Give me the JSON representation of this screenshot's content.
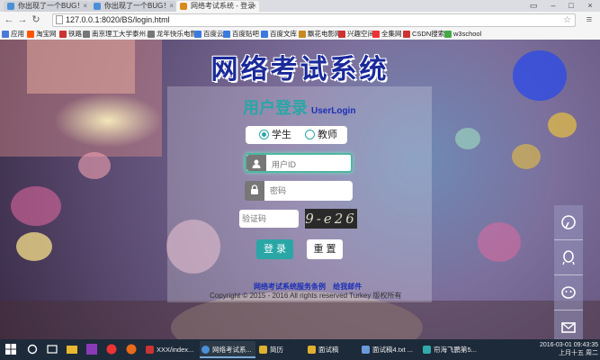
{
  "browser": {
    "tabs": [
      {
        "label": "你出现了一个BUG！",
        "icon_color": "#4a90d9"
      },
      {
        "label": "你出现了一个BUG！",
        "icon_color": "#4a90d9"
      },
      {
        "label": "网络考试系统 - 登录",
        "icon_color": "#d98a1a"
      }
    ],
    "url": "127.0.0.1:8020/BS/login.html",
    "bookmarks": [
      {
        "label": "应用",
        "color": "#4a7ad9"
      },
      {
        "label": "淘宝网",
        "color": "#ff5500"
      },
      {
        "label": "铁路",
        "color": "#c33"
      },
      {
        "label": "南京理工大学泰州...",
        "color": "#777"
      },
      {
        "label": "龙年快乐电影",
        "color": "#777"
      },
      {
        "label": "百度云",
        "color": "#3a7ae0"
      },
      {
        "label": "百度贴吧",
        "color": "#3a7ae0"
      },
      {
        "label": "百度文库",
        "color": "#3a7ae0"
      },
      {
        "label": "飘花电影网",
        "color": "#c98a20"
      },
      {
        "label": "兴趣空间",
        "color": "#c33"
      },
      {
        "label": "全集网",
        "color": "#e33"
      },
      {
        "label": "CSDN搜索",
        "color": "#c33"
      },
      {
        "label": "w3school",
        "color": "#4a4"
      }
    ]
  },
  "page": {
    "title": "网络考试系统",
    "login_heading": "用户登录",
    "login_heading_en": "UserLogin",
    "roles": [
      "学生",
      "教师"
    ],
    "selected_role": "学生",
    "userid_placeholder": "用户ID",
    "password_placeholder": "密码",
    "captcha_placeholder": "验证码",
    "captcha_text": "9-e26",
    "login_button": "登 录",
    "reset_button": "重 置",
    "footer_links": [
      "网络考试系统服务条例",
      "给我邮件"
    ],
    "copyright": "Copyright © 2015 - 2016 All rights reserved Turkey 版权所有"
  },
  "sidebar_icons": [
    "help-icon",
    "qq-icon",
    "wechat-icon",
    "mail-icon"
  ],
  "taskbar": {
    "items": [
      {
        "label": "XXX/index...",
        "color": "#c33"
      },
      {
        "label": "网络考试系...",
        "color": "#4a90d9"
      },
      {
        "label": "简历",
        "color": "#e0b030"
      },
      {
        "label": "面试稿",
        "color": "#e0b030"
      },
      {
        "label": "面试稿4.txt ...",
        "color": "#6a9ad9"
      },
      {
        "label": "帘海飞鹏第5...",
        "color": "#3aa"
      }
    ],
    "time": "09:43:35",
    "date": "2016-03-01",
    "weekday": "上月十五 周二"
  }
}
